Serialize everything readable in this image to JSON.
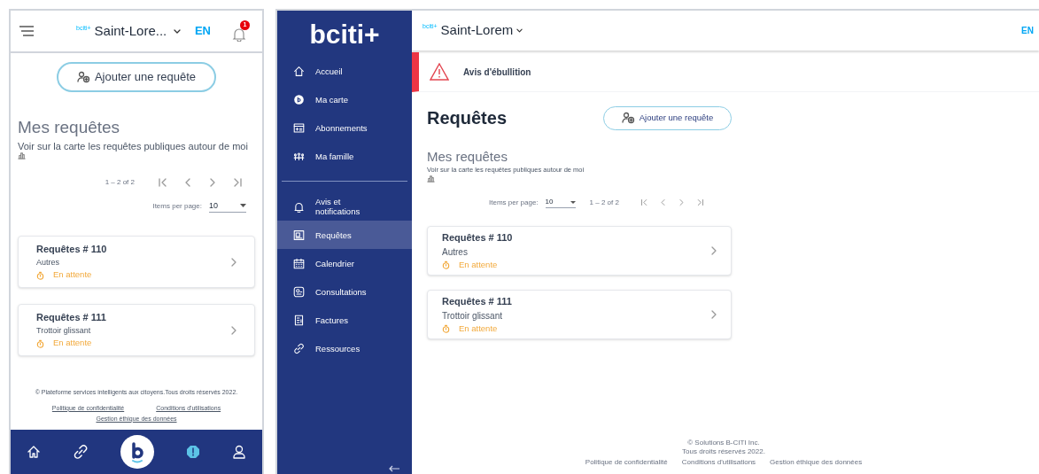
{
  "mobile": {
    "header": {
      "logo": "bciti",
      "logo_plus": "+",
      "city": "Saint-Lore...",
      "language": "EN",
      "notification_count": "1"
    },
    "add_button": "Ajouter une requête",
    "section_title": "Mes requêtes",
    "map_link": "Voir sur la carte les requêtes publiques autour de moi",
    "range": "1 – 2 of 2",
    "items_per_page_label": "Items per page:",
    "items_per_page": "10",
    "requests": [
      {
        "title": "Requêtes # 110",
        "category": "Autres",
        "status": "En attente"
      },
      {
        "title": "Requêtes # 111",
        "category": "Trottoir glissant",
        "status": "En attente"
      }
    ],
    "footer": {
      "copyright": "© Plateforme services intelligents aux citoyens.Tous droits réservés 2022.",
      "links": [
        "Politique de confidentialité",
        "Conditions d'utilisations",
        "Gestion éthique des données"
      ]
    },
    "bottom_nav": [
      {
        "kind": "home"
      },
      {
        "kind": "link"
      },
      {
        "kind": "logo"
      },
      {
        "kind": "alert"
      },
      {
        "kind": "user"
      }
    ]
  },
  "desktop": {
    "logo": "bciti",
    "logo_plus": "+",
    "sidebar": {
      "groups": [
        [
          {
            "label": "Accueil",
            "selected": false
          },
          {
            "label": "Ma carte",
            "selected": false
          },
          {
            "label": "Abonnements",
            "selected": false
          },
          {
            "label": "Ma famille",
            "selected": false
          }
        ],
        [
          {
            "label": "Avis et notifications",
            "selected": false
          },
          {
            "label": "Requêtes",
            "selected": true
          },
          {
            "label": "Calendrier",
            "selected": false
          },
          {
            "label": "Consultations",
            "selected": false
          },
          {
            "label": "Factures",
            "selected": false
          },
          {
            "label": "Ressources",
            "selected": false
          }
        ]
      ]
    },
    "header": {
      "logo": "bciti",
      "logo_plus": "+",
      "city": "Saint-Lorem",
      "language": "EN"
    },
    "alert": "Avis d'ébullition",
    "page_title": "Requêtes",
    "add_button": "Ajouter une requête",
    "section_title": "Mes requêtes",
    "map_link": "Voir sur la carte les requêtes publiques autour de moi",
    "items_per_page_label": "Items per page:",
    "items_per_page": "10",
    "range": "1 – 2 of 2",
    "requests": [
      {
        "title": "Requêtes # 110",
        "category": "Autres",
        "status": "En attente"
      },
      {
        "title": "Requêtes # 111",
        "category": "Trottoir glissant",
        "status": "En attente"
      }
    ],
    "footer": {
      "copyright": [
        "© Solutions B-CITI Inc.",
        "Tous droits réservés 2022."
      ],
      "links": [
        "Politique de confidentialité",
        "Conditions d'utilisations",
        "Gestion éthique des données"
      ]
    }
  }
}
